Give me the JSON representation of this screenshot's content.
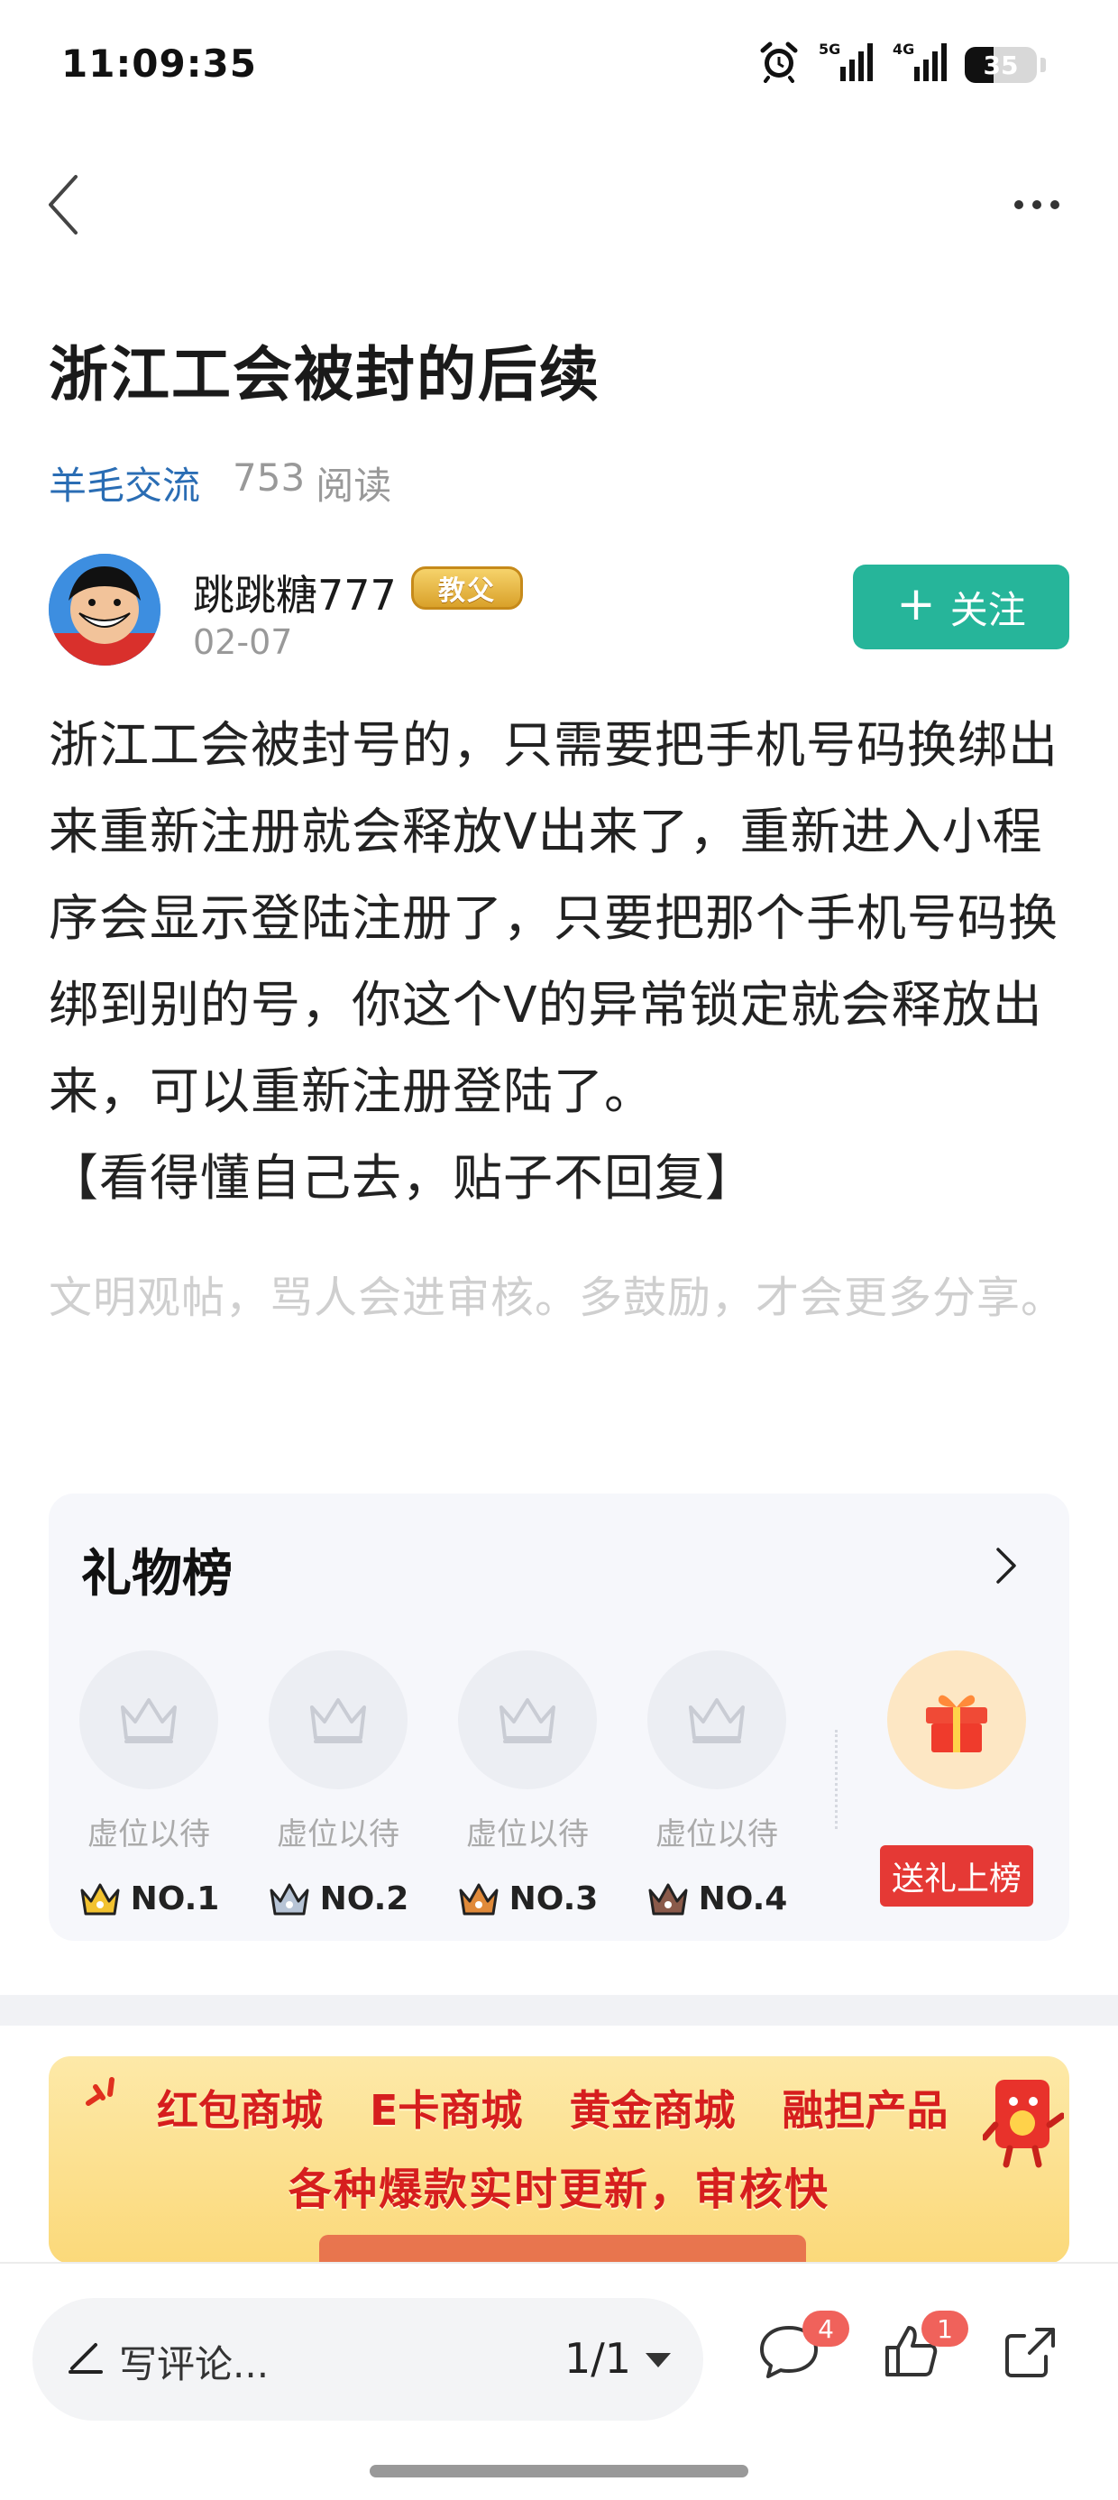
{
  "status_bar": {
    "time": "11:09:35",
    "signal1_label": "5G",
    "signal2_label": "4G",
    "battery": "35"
  },
  "nav": {
    "back_icon": "chevron-left-icon",
    "more_icon": "more-horizontal-icon"
  },
  "article": {
    "title": "浙江工会被封的后续",
    "forum": "羊毛交流",
    "read_count": "753",
    "read_label": "阅读",
    "author": {
      "name": "跳跳糖777",
      "badge": "教父",
      "date": "02-07"
    },
    "follow_label": "关注",
    "body": [
      "浙江工会被封号的，只需要把手机号码换绑出来重新注册就会释放V出来了，重新进入小程序会显示登陆注册了，只要把那个手机号码换绑到别的号，你这个V的异常锁定就会释放出来，可以重新注册登陆了。",
      "【看得懂自己去，贴子不回复】"
    ],
    "civility_note": "文明观帖，骂人会进审核。多鼓励，才会更多分享。"
  },
  "gift_board": {
    "title": "礼物榜",
    "slots": [
      {
        "label": "虚位以待",
        "rank": "NO.1",
        "crown_color": "#f2c230"
      },
      {
        "label": "虚位以待",
        "rank": "NO.2",
        "crown_color": "#b7c4d6"
      },
      {
        "label": "虚位以待",
        "rank": "NO.3",
        "crown_color": "#e08a3a"
      },
      {
        "label": "虚位以待",
        "rank": "NO.4",
        "crown_color": "#8a5a4a"
      }
    ],
    "send_label": "送礼上榜"
  },
  "ad": {
    "line1": [
      "红包商城",
      "E卡商城",
      "黄金商城",
      "融担产品"
    ],
    "line2": "各种爆款实时更新，审核快"
  },
  "bottom_bar": {
    "comment_placeholder": "写评论...",
    "page": "1/1",
    "comment_count": "4",
    "like_count": "1",
    "share_icon": "share-icon"
  },
  "colors": {
    "accent": "#26b59a",
    "link": "#2a6db4",
    "badge_red": "#f0625b",
    "gift_button": "#e53935"
  }
}
